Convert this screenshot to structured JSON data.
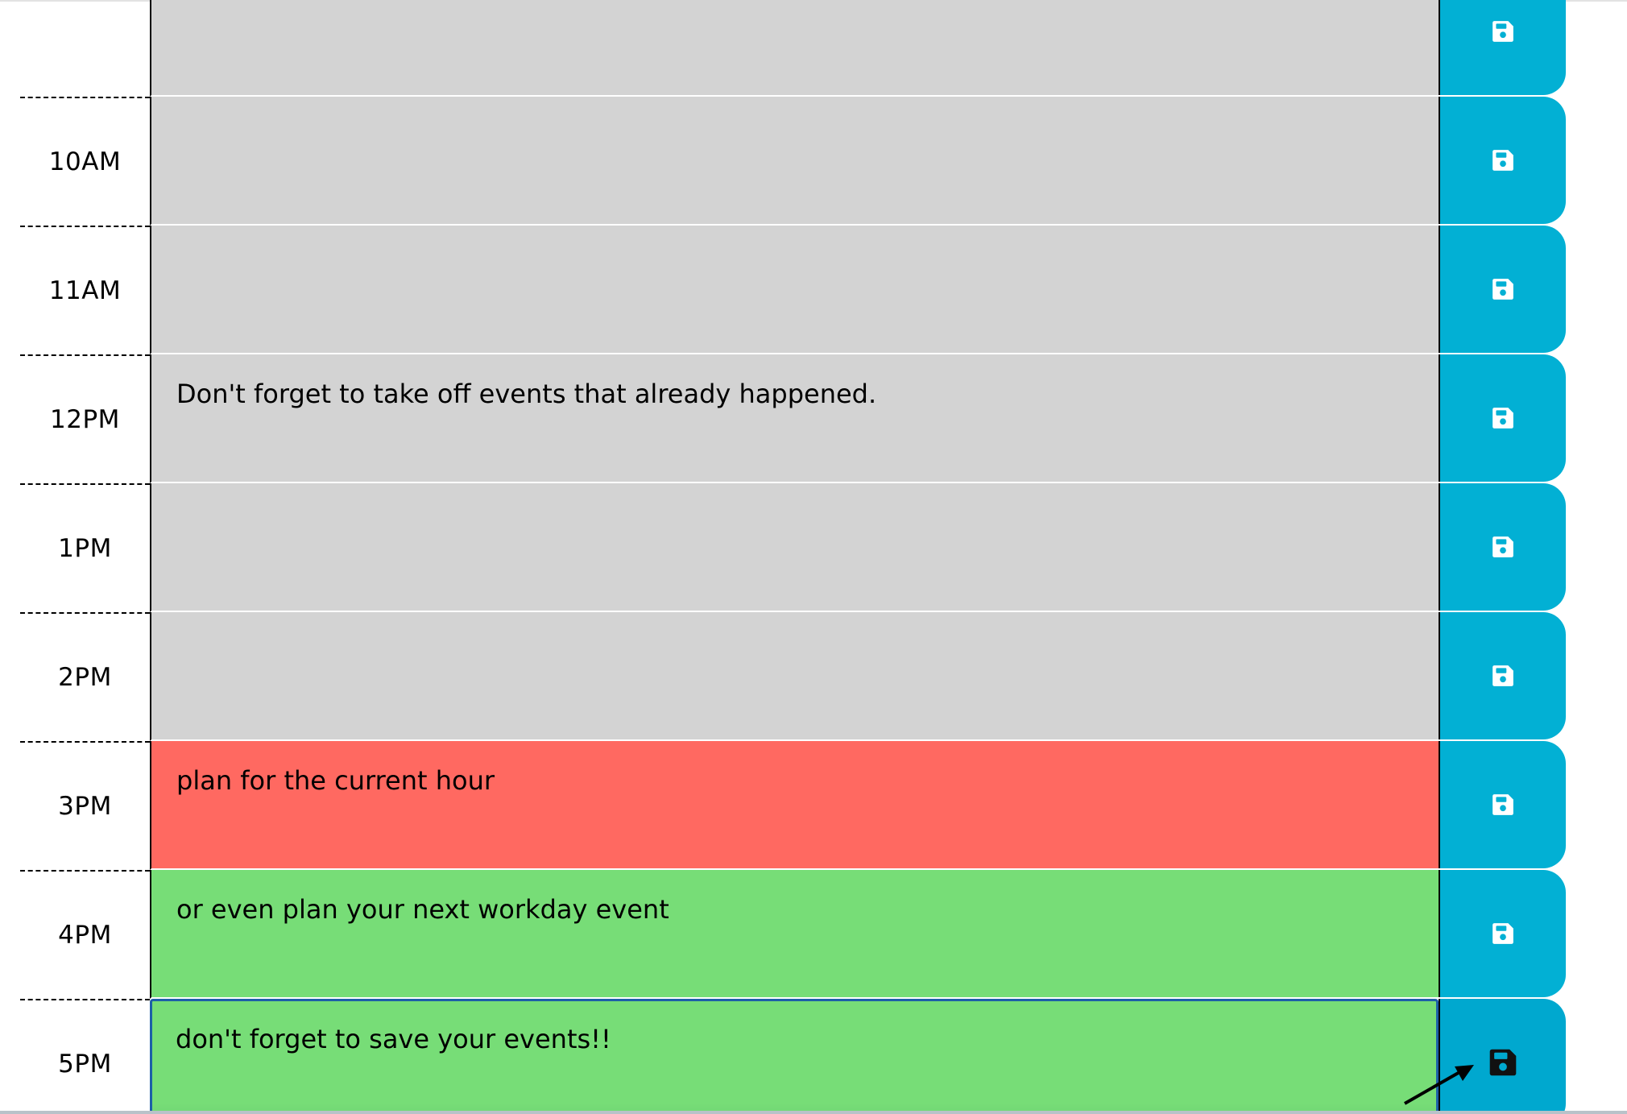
{
  "colors": {
    "past": "#d3d3d3",
    "present": "#ff6961",
    "future": "#77dd77",
    "save_button": "#02b0d4",
    "save_icon": "#ffffff",
    "save_icon_active": "#000000"
  },
  "planner": {
    "rows": [
      {
        "hour": "",
        "state": "past",
        "text": "",
        "save_icon": "floppy-disk-icon"
      },
      {
        "hour": "10AM",
        "state": "past",
        "text": "",
        "save_icon": "floppy-disk-icon"
      },
      {
        "hour": "11AM",
        "state": "past",
        "text": "",
        "save_icon": "floppy-disk-icon"
      },
      {
        "hour": "12PM",
        "state": "past",
        "text": "Don't forget to take off events that already happened.",
        "save_icon": "floppy-disk-icon"
      },
      {
        "hour": "1PM",
        "state": "past",
        "text": "",
        "save_icon": "floppy-disk-icon"
      },
      {
        "hour": "2PM",
        "state": "past",
        "text": "",
        "save_icon": "floppy-disk-icon"
      },
      {
        "hour": "3PM",
        "state": "present",
        "text": "plan for the current hour",
        "save_icon": "floppy-disk-icon"
      },
      {
        "hour": "4PM",
        "state": "future",
        "text": "or even plan your next workday event",
        "save_icon": "floppy-disk-icon"
      },
      {
        "hour": "5PM",
        "state": "future",
        "text": "don't forget to save your events!!",
        "save_icon": "floppy-disk-icon"
      }
    ]
  }
}
